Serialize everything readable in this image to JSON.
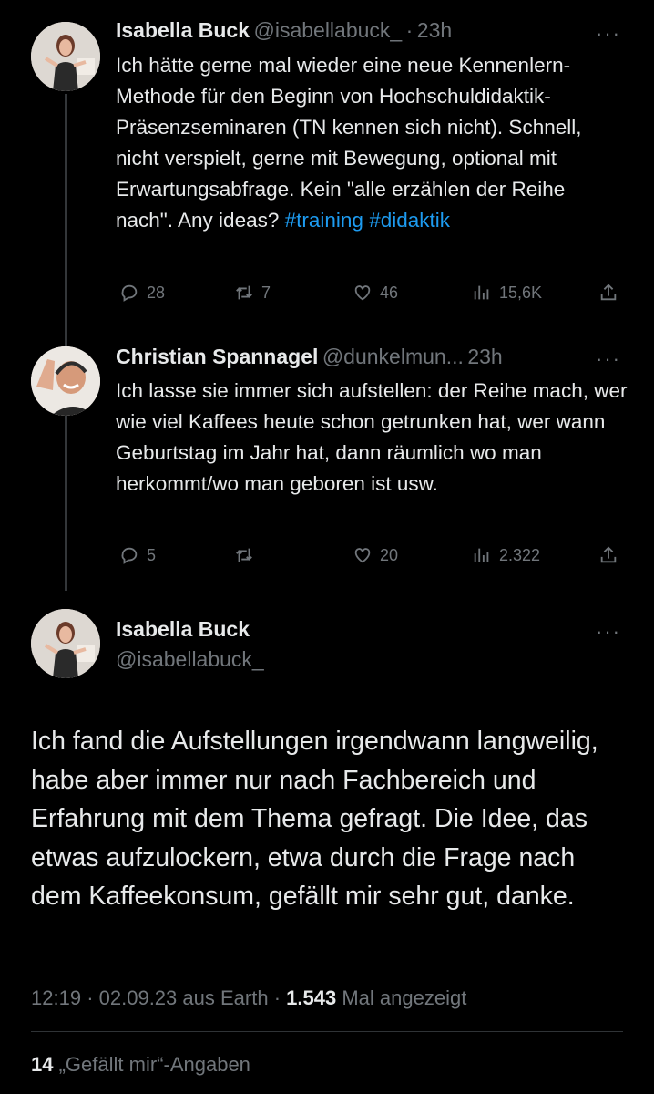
{
  "tweets": [
    {
      "name": "Isabella Buck",
      "handle": "@isabellabuck_",
      "time": "23h",
      "text": "Ich hätte gerne mal wieder eine neue Kennenlern-Methode für den Beginn von Hochschuldidaktik-Präsenzseminaren (TN kennen sich nicht). Schnell, nicht verspielt, gerne mit Bewegung, optional mit Erwartungsabfrage. Kein \"alle erzählen der Reihe nach\". Any ideas?",
      "hashtags": [
        "#training",
        "#didaktik"
      ],
      "replies": "28",
      "retweets": "7",
      "likes": "46",
      "views": "15,6K"
    },
    {
      "name": "Christian Spannagel",
      "handle": "@dunkelmun...",
      "time": "23h",
      "text": "Ich lasse sie immer sich aufstellen: der Reihe mach, wer wie viel Kaffees heute schon getrunken hat, wer wann Geburtstag im Jahr hat, dann räumlich wo man herkommt/wo man geboren ist usw.",
      "replies": "5",
      "retweets": "",
      "likes": "20",
      "views": "2.322"
    }
  ],
  "main_tweet": {
    "name": "Isabella Buck",
    "handle": "@isabellabuck_",
    "text": "Ich fand die Aufstellungen irgendwann langweilig, habe aber immer nur nach Fachbereich und Erfahrung mit dem Thema gefragt. Die Idee, das etwas aufzulockern, etwa durch die Frage nach dem Kaffeekonsum, gefällt mir sehr gut, danke.",
    "time": "12:19",
    "date": "02.09.23",
    "source": "aus Earth",
    "views_count": "1.543",
    "views_label": "Mal angezeigt",
    "likes_count": "14",
    "likes_label": "„Gefällt mir“-Angaben"
  },
  "ui": {
    "separator": "·",
    "more": "···"
  },
  "icons": {
    "reply": "reply-icon",
    "retweet": "retweet-icon",
    "like": "heart-icon",
    "views": "views-icon",
    "share": "share-icon"
  }
}
